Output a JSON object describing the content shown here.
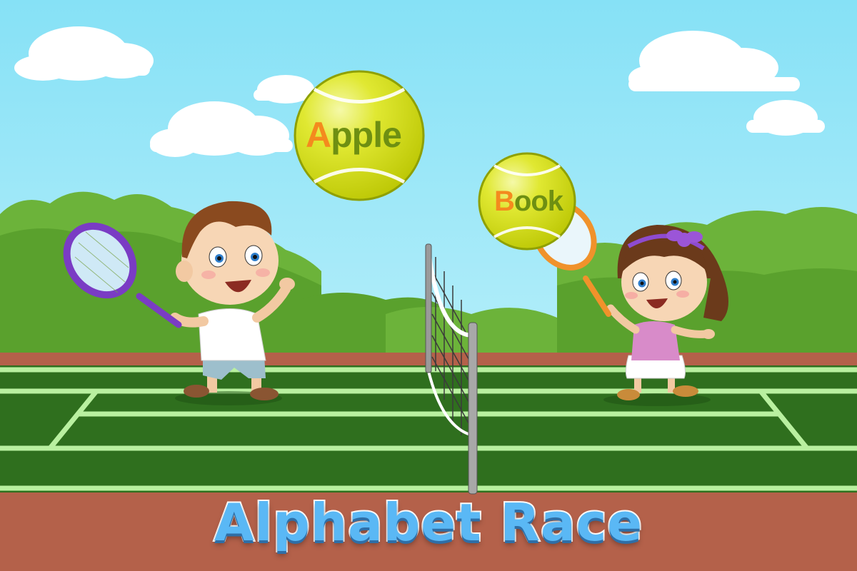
{
  "game": {
    "title": "Alphabet Race",
    "balls": [
      {
        "first_letter": "A",
        "rest": "pple"
      },
      {
        "first_letter": "B",
        "rest": "ook"
      }
    ]
  },
  "colors": {
    "sky": "#8fe4f7",
    "court": "#2f6f1e",
    "court_lines": "#b9f0a0",
    "clay": "#b4614a",
    "ball": "#d6e00a",
    "title_fill": "#5ab8f5",
    "highlight_letter": "#f48a1e",
    "word_text": "#6e8f12"
  }
}
